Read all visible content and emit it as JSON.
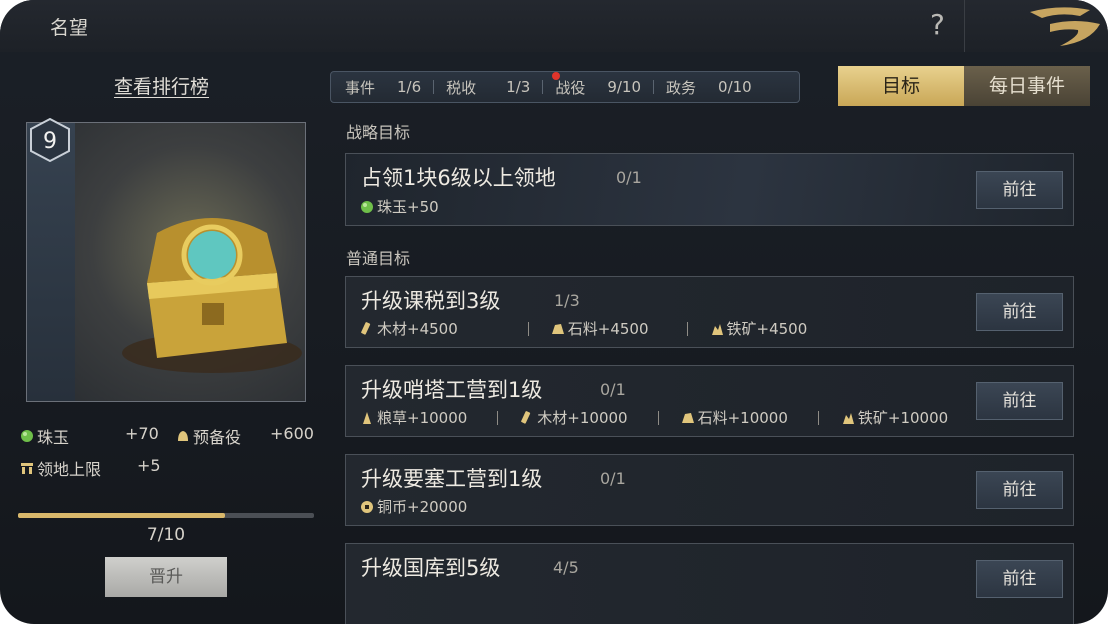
{
  "window": {
    "title": "名望",
    "help": "?"
  },
  "left": {
    "rank_link": "查看排行榜",
    "level": "9",
    "stats": [
      {
        "icon": "jade-icon",
        "label": "珠玉",
        "value": "+70"
      },
      {
        "icon": "reserve-soldier-icon",
        "label": "预备役",
        "value": "+600"
      },
      {
        "icon": "territory-icon",
        "label": "领地上限",
        "value": "+5"
      }
    ],
    "progress": {
      "current": 7,
      "max": 10,
      "text": "7/10"
    },
    "upgrade_button": "晋升"
  },
  "tabs_strip": [
    {
      "label": "事件",
      "count": "1/6"
    },
    {
      "label": "税收",
      "count": "1/3",
      "alert": true
    },
    {
      "label": "战役",
      "count": "9/10"
    },
    {
      "label": "政务",
      "count": "0/10"
    }
  ],
  "view_tabs": {
    "goal": "目标",
    "daily": "每日事件",
    "active": "goal"
  },
  "sections": {
    "strategic": "战略目标",
    "normal": "普通目标"
  },
  "go_label": "前往",
  "strategic_items": [
    {
      "name": "占领1块6级以上领地",
      "count": "0/1",
      "rewards": [
        {
          "icon": "jade-icon",
          "text": "珠玉+50"
        }
      ]
    }
  ],
  "normal_items": [
    {
      "name": "升级课税到3级",
      "count": "1/3",
      "rewards": [
        {
          "icon": "wood-icon",
          "text": "木材+4500"
        },
        {
          "icon": "stone-icon",
          "text": "石料+4500"
        },
        {
          "icon": "iron-icon",
          "text": "铁矿+4500"
        }
      ]
    },
    {
      "name": "升级哨塔工营到1级",
      "count": "0/1",
      "rewards": [
        {
          "icon": "grain-icon",
          "text": "粮草+10000"
        },
        {
          "icon": "wood-icon",
          "text": "木材+10000"
        },
        {
          "icon": "stone-icon",
          "text": "石料+10000"
        },
        {
          "icon": "iron-icon",
          "text": "铁矿+10000"
        }
      ]
    },
    {
      "name": "升级要塞工营到1级",
      "count": "0/1",
      "rewards": [
        {
          "icon": "copper-coin-icon",
          "text": "铜币+20000"
        }
      ]
    },
    {
      "name": "升级国库到5级",
      "count": "4/5",
      "rewards": []
    }
  ],
  "colors": {
    "accent_gold": "#e0c57c",
    "alert_red": "#e0342b",
    "jade_green": "#6fbf4a"
  }
}
